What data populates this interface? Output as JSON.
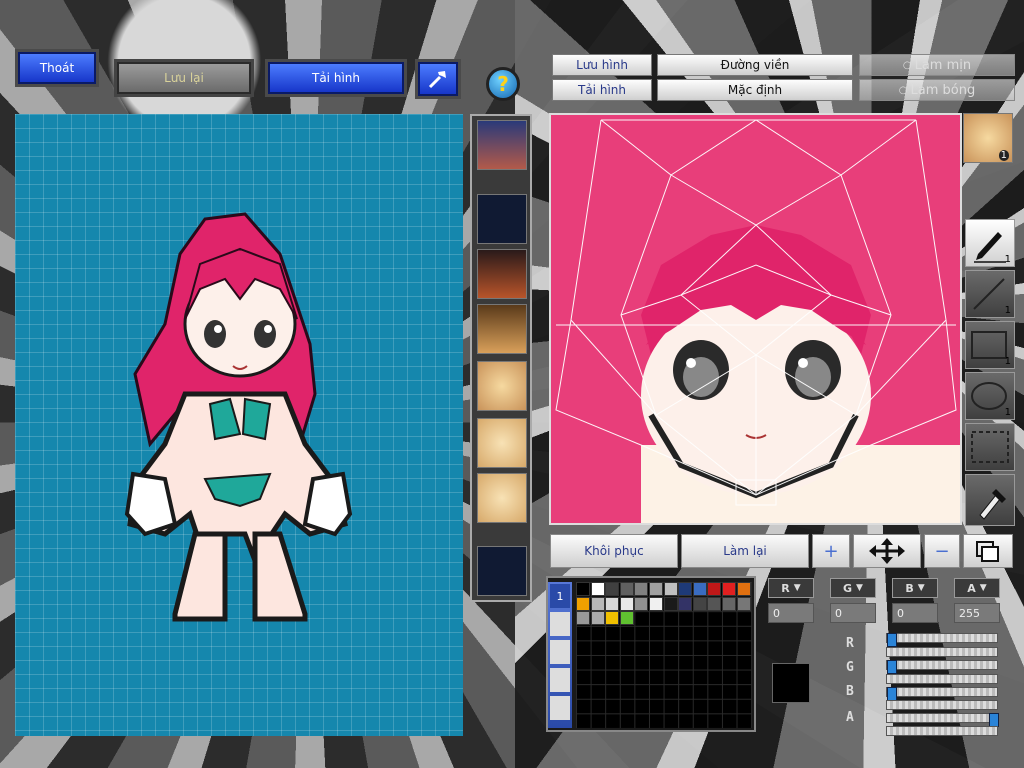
{
  "toolbar": {
    "exit_label": "Thoát",
    "save_label": "Lưu lại",
    "load_label": "Tải hình",
    "help_label": "?"
  },
  "editor": {
    "save_image_label": "Lưu hình",
    "load_image_label": "Tải hình",
    "outline_label": "Đường viền",
    "default_label": "Mặc định",
    "smooth_label": "Làm mịn",
    "shine_label": "Làm bóng",
    "restore_label": "Khôi phục",
    "redo_label": "Làm lại"
  },
  "tools": [
    {
      "name": "pen",
      "count": "1"
    },
    {
      "name": "line",
      "count": "1"
    },
    {
      "name": "rectangle",
      "count": "1"
    },
    {
      "name": "ellipse",
      "count": "1"
    },
    {
      "name": "select",
      "count": ""
    },
    {
      "name": "eyedropper",
      "count": ""
    }
  ],
  "face_thumb_count": "1",
  "layer_tab": "1",
  "palette": [
    "#000000",
    "#ffffff",
    "#404040",
    "#606060",
    "#808080",
    "#a0a0a0",
    "#c0c0c0",
    "#1e3a78",
    "#3a6cc0",
    "#c01818",
    "#e02020",
    "#e07010",
    "#f0a000",
    "#b8b8b8",
    "#d8d8d8",
    "#e8e8e8",
    "#909090",
    "#f0f0f0",
    "#1a1a1a",
    "#333366",
    "#444444",
    "#555555",
    "#666666",
    "#777777",
    "#999999",
    "#aaaaaa",
    "#f0c000",
    "#60c030"
  ],
  "channels": {
    "r_label": "R",
    "g_label": "G",
    "b_label": "B",
    "a_label": "A",
    "r_value": "0",
    "g_value": "0",
    "b_value": "0",
    "a_value": "255",
    "r_level": 0,
    "g_level": 0,
    "b_level": 0,
    "a_level": 1
  },
  "current_color": "#000000"
}
